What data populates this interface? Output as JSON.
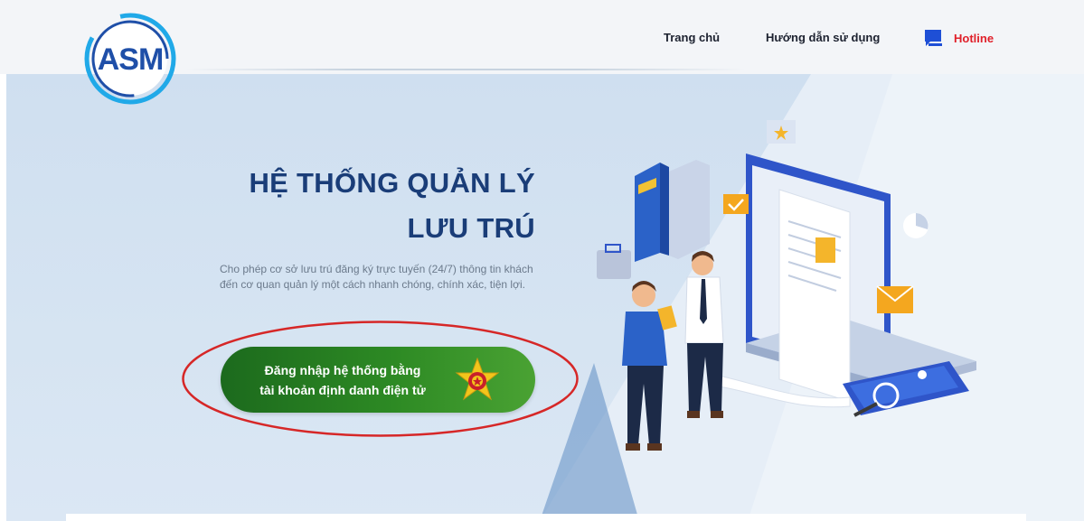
{
  "header": {
    "logo_text": "ASM",
    "nav": {
      "home": "Trang chủ",
      "guide": "Hướng dẫn sử dụng",
      "hotline": "Hotline"
    }
  },
  "hero": {
    "title_line1": "HỆ THỐNG QUẢN LÝ",
    "title_line2": "LƯU TRÚ",
    "description": "Cho phép cơ sở lưu trú đăng ký trực tuyến (24/7) thông tin khách đến cơ quan quản lý một cách nhanh chóng, chính xác, tiện lợi.",
    "login_button": {
      "line1": "Đăng nhập hệ thống bằng",
      "line2": "tài khoản định danh điện tử"
    }
  },
  "colors": {
    "title": "#1a3d78",
    "hotline": "#e0202a",
    "login_button": "#2d8a24",
    "annotation": "#d62727",
    "logo_blue": "#1f4fa8",
    "logo_cyan": "#20a9e8"
  },
  "icons": {
    "hotline_icon": "chat-icon",
    "login_emblem": "police-emblem-icon"
  }
}
